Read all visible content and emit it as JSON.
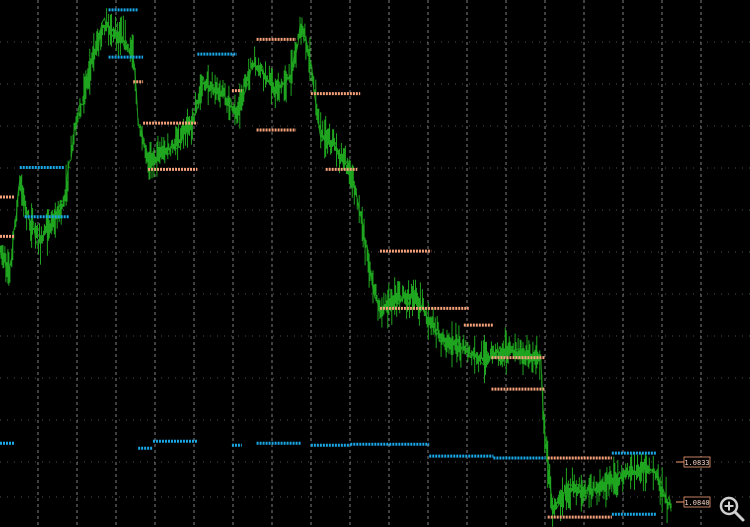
{
  "chart_data": {
    "type": "line",
    "title": "",
    "xlabel": "",
    "ylabel": "",
    "price_axis": {
      "min": 1.079,
      "max": 1.1325
    },
    "bar_count": 760,
    "grid": true,
    "colors": {
      "background": "#000000",
      "grid": "#d8d8d8",
      "price": "#1fa51f",
      "support": "#1aa7e6",
      "resistance": "#f4a07a"
    },
    "price_path": [
      {
        "bar": 0,
        "price": 1.107
      },
      {
        "bar": 10,
        "price": 1.105
      },
      {
        "bar": 20,
        "price": 1.114
      },
      {
        "bar": 30,
        "price": 1.11
      },
      {
        "bar": 40,
        "price": 1.108
      },
      {
        "bar": 55,
        "price": 1.11
      },
      {
        "bar": 65,
        "price": 1.112
      },
      {
        "bar": 75,
        "price": 1.119
      },
      {
        "bar": 85,
        "price": 1.123
      },
      {
        "bar": 95,
        "price": 1.127
      },
      {
        "bar": 105,
        "price": 1.13
      },
      {
        "bar": 120,
        "price": 1.129
      },
      {
        "bar": 135,
        "price": 1.127
      },
      {
        "bar": 140,
        "price": 1.12
      },
      {
        "bar": 150,
        "price": 1.116
      },
      {
        "bar": 165,
        "price": 1.117
      },
      {
        "bar": 180,
        "price": 1.118
      },
      {
        "bar": 195,
        "price": 1.12
      },
      {
        "bar": 205,
        "price": 1.124
      },
      {
        "bar": 215,
        "price": 1.1235
      },
      {
        "bar": 225,
        "price": 1.123
      },
      {
        "bar": 240,
        "price": 1.121
      },
      {
        "bar": 255,
        "price": 1.126
      },
      {
        "bar": 265,
        "price": 1.1255
      },
      {
        "bar": 280,
        "price": 1.123
      },
      {
        "bar": 295,
        "price": 1.125
      },
      {
        "bar": 305,
        "price": 1.13
      },
      {
        "bar": 315,
        "price": 1.126
      },
      {
        "bar": 325,
        "price": 1.119
      },
      {
        "bar": 340,
        "price": 1.1175
      },
      {
        "bar": 355,
        "price": 1.115
      },
      {
        "bar": 365,
        "price": 1.111
      },
      {
        "bar": 375,
        "price": 1.105
      },
      {
        "bar": 385,
        "price": 1.101
      },
      {
        "bar": 400,
        "price": 1.102
      },
      {
        "bar": 420,
        "price": 1.1025
      },
      {
        "bar": 435,
        "price": 1.1
      },
      {
        "bar": 450,
        "price": 1.098
      },
      {
        "bar": 470,
        "price": 1.097
      },
      {
        "bar": 490,
        "price": 1.096
      },
      {
        "bar": 510,
        "price": 1.097
      },
      {
        "bar": 530,
        "price": 1.0965
      },
      {
        "bar": 548,
        "price": 1.096
      },
      {
        "bar": 552,
        "price": 1.088
      },
      {
        "bar": 560,
        "price": 1.081
      },
      {
        "bar": 575,
        "price": 1.083
      },
      {
        "bar": 590,
        "price": 1.0825
      },
      {
        "bar": 605,
        "price": 1.083
      },
      {
        "bar": 620,
        "price": 1.0835
      },
      {
        "bar": 640,
        "price": 1.0845
      },
      {
        "bar": 655,
        "price": 1.085
      },
      {
        "bar": 665,
        "price": 1.0845
      },
      {
        "bar": 675,
        "price": 1.0815
      },
      {
        "bar": 680,
        "price": 1.0812
      }
    ],
    "support_levels": [
      {
        "bar_start": 0,
        "bar_end": 15,
        "price": 1.0875
      },
      {
        "bar_start": 20,
        "bar_end": 65,
        "price": 1.1155
      },
      {
        "bar_start": 25,
        "bar_end": 70,
        "price": 1.1105
      },
      {
        "bar_start": 110,
        "bar_end": 140,
        "price": 1.1315
      },
      {
        "bar_start": 110,
        "bar_end": 145,
        "price": 1.1267
      },
      {
        "bar_start": 140,
        "bar_end": 155,
        "price": 1.087
      },
      {
        "bar_start": 155,
        "bar_end": 200,
        "price": 1.0877
      },
      {
        "bar_start": 200,
        "bar_end": 240,
        "price": 1.127
      },
      {
        "bar_start": 235,
        "bar_end": 245,
        "price": 1.0873
      },
      {
        "bar_start": 260,
        "bar_end": 305,
        "price": 1.0875
      },
      {
        "bar_start": 315,
        "bar_end": 355,
        "price": 1.0873
      },
      {
        "bar_start": 355,
        "bar_end": 435,
        "price": 1.0874
      },
      {
        "bar_start": 435,
        "bar_end": 500,
        "price": 1.0862
      },
      {
        "bar_start": 500,
        "bar_end": 553,
        "price": 1.086
      },
      {
        "bar_start": 620,
        "bar_end": 665,
        "price": 1.0865
      },
      {
        "bar_start": 620,
        "bar_end": 665,
        "price": 1.0803
      }
    ],
    "resistance_levels": [
      {
        "bar_start": 0,
        "bar_end": 15,
        "price": 1.1125
      },
      {
        "bar_start": 0,
        "bar_end": 15,
        "price": 1.1085
      },
      {
        "bar_start": 135,
        "bar_end": 145,
        "price": 1.1242
      },
      {
        "bar_start": 145,
        "bar_end": 200,
        "price": 1.12
      },
      {
        "bar_start": 150,
        "bar_end": 200,
        "price": 1.1153
      },
      {
        "bar_start": 235,
        "bar_end": 245,
        "price": 1.1233
      },
      {
        "bar_start": 260,
        "bar_end": 300,
        "price": 1.1285
      },
      {
        "bar_start": 260,
        "bar_end": 300,
        "price": 1.1193
      },
      {
        "bar_start": 315,
        "bar_end": 365,
        "price": 1.123
      },
      {
        "bar_start": 330,
        "bar_end": 362,
        "price": 1.1153
      },
      {
        "bar_start": 385,
        "bar_end": 437,
        "price": 1.107
      },
      {
        "bar_start": 385,
        "bar_end": 437,
        "price": 1.1012
      },
      {
        "bar_start": 437,
        "bar_end": 475,
        "price": 1.1012
      },
      {
        "bar_start": 470,
        "bar_end": 500,
        "price": 1.0995
      },
      {
        "bar_start": 498,
        "bar_end": 552,
        "price": 1.0962
      },
      {
        "bar_start": 498,
        "bar_end": 552,
        "price": 1.093
      },
      {
        "bar_start": 555,
        "bar_end": 620,
        "price": 1.086
      },
      {
        "bar_start": 555,
        "bar_end": 620,
        "price": 1.08
      }
    ],
    "price_labels": [
      "1.0833",
      "1.0840"
    ]
  },
  "toolbar": {
    "zoom_icon": "zoom-in-icon"
  }
}
